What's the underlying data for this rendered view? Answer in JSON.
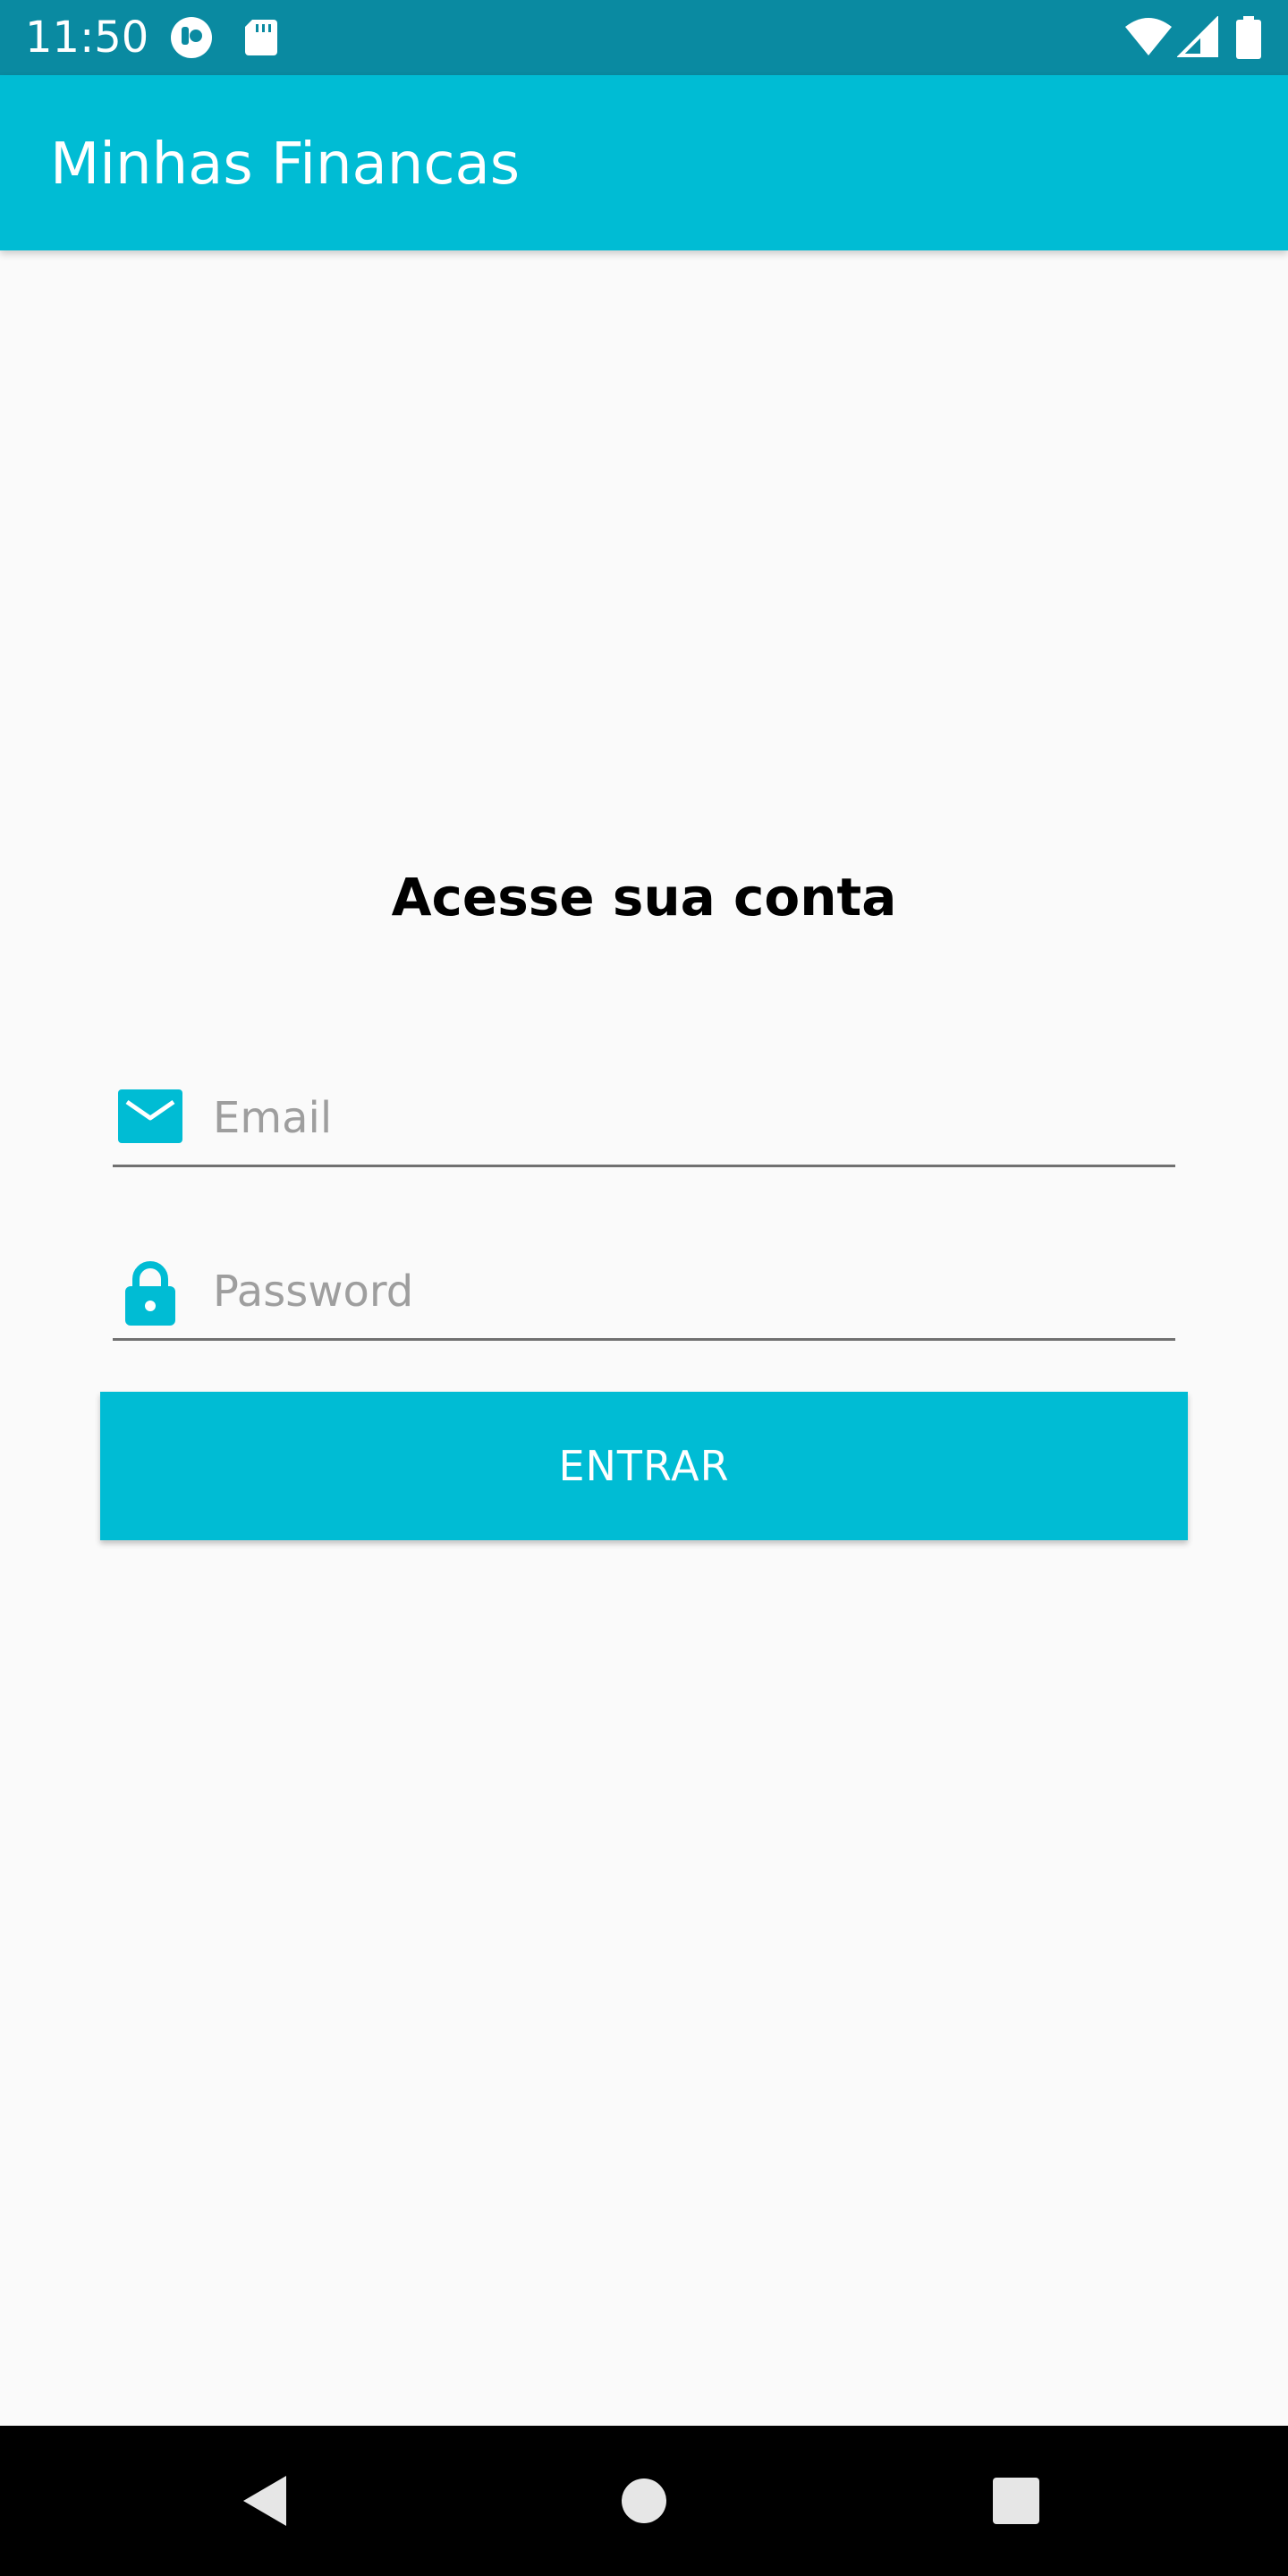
{
  "status_bar": {
    "time": "11:50",
    "icons": [
      "app-notification-icon",
      "sd-card-icon",
      "wifi-icon",
      "signal-icon",
      "battery-icon"
    ]
  },
  "app_bar": {
    "title": "Minhas Financas"
  },
  "login": {
    "heading": "Acesse sua conta",
    "email": {
      "icon": "email-icon",
      "placeholder": "Email",
      "value": ""
    },
    "password": {
      "icon": "lock-icon",
      "placeholder": "Password",
      "value": ""
    },
    "submit_label": "ENTRAR"
  },
  "nav_bar": {
    "buttons": [
      "back-icon",
      "home-icon",
      "recents-icon"
    ]
  },
  "colors": {
    "primary": "#00bcd4",
    "primary_dark": "#0a8aa1",
    "background": "#fafafa"
  }
}
